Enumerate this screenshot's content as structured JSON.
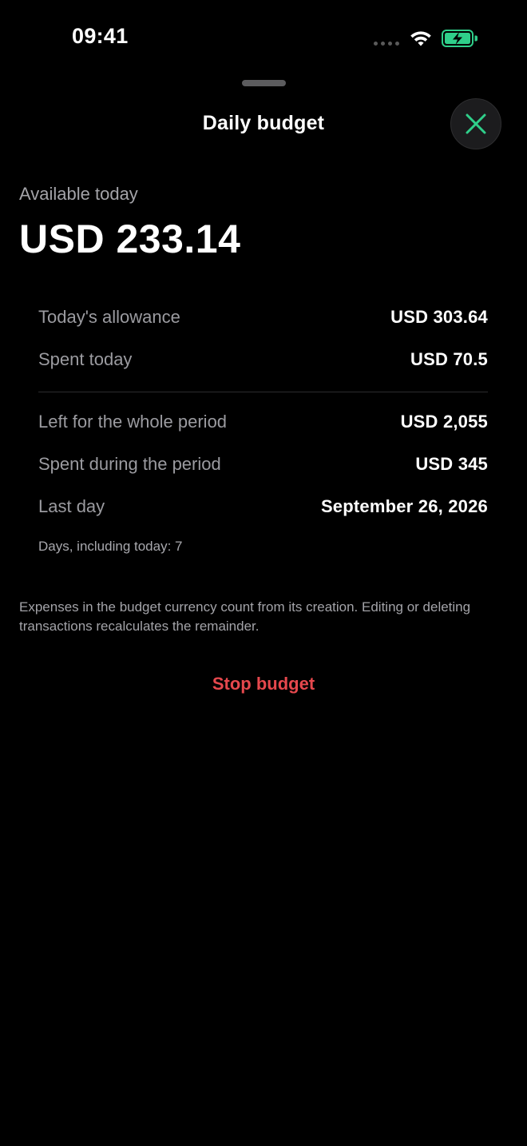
{
  "status_bar": {
    "time": "09:41"
  },
  "sheet": {
    "title": "Daily budget",
    "close_icon": "close-icon",
    "accent_color": "#2fcf8a"
  },
  "available": {
    "label": "Available today",
    "amount": "USD 233.14"
  },
  "today": {
    "allowance_label": "Today's allowance",
    "allowance_value": "USD 303.64",
    "spent_label": "Spent today",
    "spent_value": "USD 70.5"
  },
  "period": {
    "left_label": "Left for the whole period",
    "left_value": "USD 2,055",
    "spent_label": "Spent during the period",
    "spent_value": "USD 345",
    "last_day_label": "Last day",
    "last_day_value": "September 26, 2026",
    "days_note": "Days, including today: 7"
  },
  "info_text": "Expenses in the budget currency count from its creation. Editing or deleting transactions recalculates the remainder.",
  "actions": {
    "stop_label": "Stop budget",
    "stop_color": "#e5484d"
  }
}
